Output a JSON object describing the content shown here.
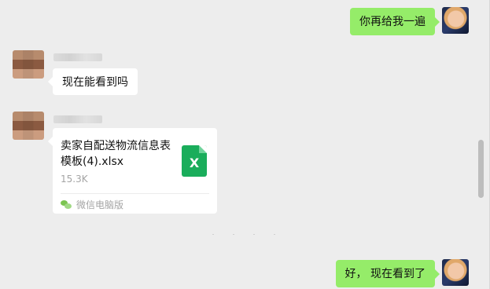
{
  "messages": [
    {
      "side": "me",
      "text": "你再给我一遍"
    },
    {
      "side": "them",
      "text": "现在能看到吗"
    },
    {
      "side": "them",
      "type": "file",
      "file": {
        "name": "卖家自配送物流信息表模板(4).xlsx",
        "size": "15.3K",
        "icon_label": "X",
        "source": "微信电脑版"
      }
    },
    {
      "side": "me",
      "text": "好， 现在看到了"
    }
  ],
  "icons": {
    "file_type": "excel-file-icon",
    "source": "wechat-icon"
  },
  "colors": {
    "my_bubble": "#95ec69",
    "their_bubble": "#ffffff",
    "background": "#ededed",
    "excel_green": "#1aad5b"
  }
}
